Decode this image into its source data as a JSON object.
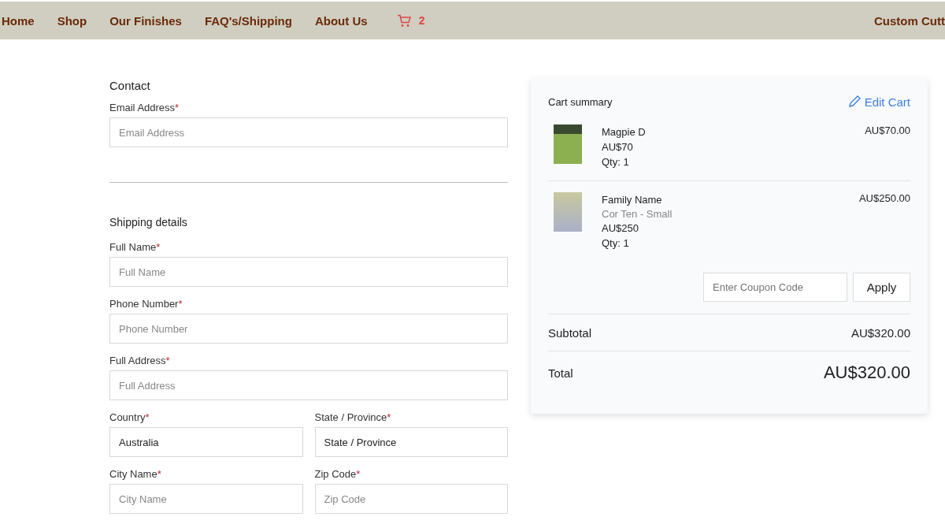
{
  "nav": {
    "links": [
      {
        "label": "Home"
      },
      {
        "label": "Shop"
      },
      {
        "label": "Our Finishes"
      },
      {
        "label": "FAQ's/Shipping"
      },
      {
        "label": "About Us"
      }
    ],
    "cart_count": "2",
    "right_link": "Custom Cutt"
  },
  "contact": {
    "title": "Contact",
    "fields": [
      {
        "label": "Email Address",
        "mark": "*",
        "placeholder": "Email Address"
      }
    ]
  },
  "shipping": {
    "title": "Shipping details",
    "rows": [
      [
        {
          "label": "Full Name",
          "mark": "*",
          "placeholder": "Full Name"
        }
      ],
      [
        {
          "label": "Phone Number",
          "mark": "*",
          "placeholder": "Phone Number"
        }
      ],
      [
        {
          "label": "Full Address",
          "mark": "*",
          "placeholder": "Full Address"
        }
      ],
      [
        {
          "label": "Country",
          "mark": "*",
          "value": "Australia"
        },
        {
          "label": "State / Province",
          "mark": "*",
          "value": "State / Province"
        }
      ],
      [
        {
          "label": "City Name",
          "mark": "*",
          "placeholder": "City Name"
        },
        {
          "label": "Zip Code",
          "mark": "*",
          "placeholder": "Zip Code"
        }
      ]
    ]
  },
  "cart": {
    "title": "Cart summary",
    "edit_link": "Edit Cart",
    "items": [
      {
        "name": "Magpie D",
        "price": "AU$70",
        "qty": "Qty: 1",
        "line_total": "AU$70.00"
      },
      {
        "name": "Family Name",
        "variant": "Cor Ten - Small",
        "price": "AU$250",
        "qty": "Qty: 1",
        "line_total": "AU$250.00"
      }
    ],
    "coupon": {
      "placeholder": "Enter Coupon Code",
      "button": "Apply"
    },
    "subtotal": {
      "label": "Subtotal",
      "value": "AU$320.00"
    },
    "total": {
      "label": "Total",
      "value": "AU$320.00"
    }
  }
}
